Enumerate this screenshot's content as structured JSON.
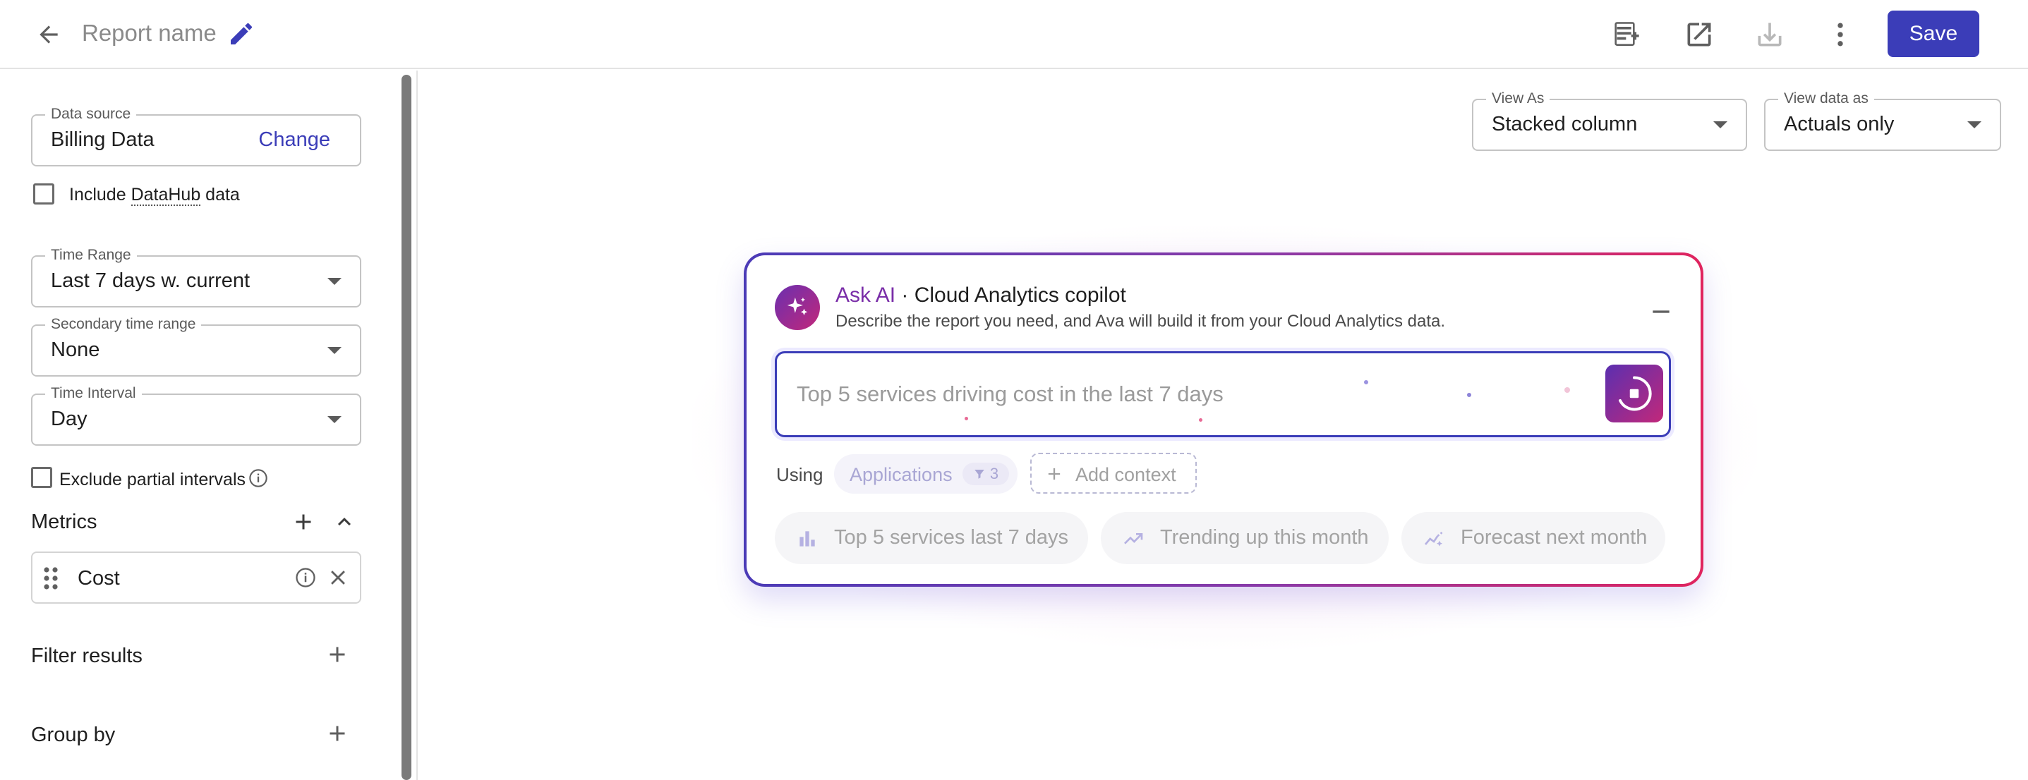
{
  "header": {
    "report_name": "Report name",
    "save_label": "Save"
  },
  "sidebar": {
    "data_source": {
      "label": "Data source",
      "value": "Billing Data",
      "change_label": "Change"
    },
    "include_datahub": {
      "prefix": "Include ",
      "link": "DataHub",
      "suffix": " data",
      "checked": false
    },
    "time_range": {
      "label": "Time Range",
      "value": "Last 7 days w. current"
    },
    "secondary_time_range": {
      "label": "Secondary time range",
      "value": "None"
    },
    "time_interval": {
      "label": "Time Interval",
      "value": "Day"
    },
    "exclude_partial": {
      "label": "Exclude partial intervals",
      "checked": false
    },
    "metrics": {
      "title": "Metrics",
      "items": [
        {
          "label": "Cost"
        }
      ]
    },
    "filter_results": {
      "title": "Filter results"
    },
    "group_by": {
      "title": "Group by"
    }
  },
  "view_as": {
    "label": "View As",
    "value": "Stacked column"
  },
  "view_data_as": {
    "label": "View data as",
    "value": "Actuals only"
  },
  "ai_panel": {
    "title_ask": "Ask AI",
    "title_rest": " · Cloud Analytics copilot",
    "subtitle": "Describe the report you need, and Ava will build it from your Cloud Analytics data.",
    "prompt_placeholder": "Top 5 services driving cost in the last 7 days",
    "using_label": "Using",
    "context_chip": {
      "label": "Applications",
      "count": "3"
    },
    "add_context_label": "Add context",
    "suggestions": [
      {
        "label": "Top 5 services last 7 days",
        "icon": "bar-chart-icon"
      },
      {
        "label": "Trending up this month",
        "icon": "trending-up-icon"
      },
      {
        "label": "Forecast next month",
        "icon": "forecast-icon"
      }
    ]
  },
  "colors": {
    "primary": "#3b3db8",
    "ai_gradient_start": "#4b3bb7",
    "ai_gradient_end": "#e0245e"
  }
}
